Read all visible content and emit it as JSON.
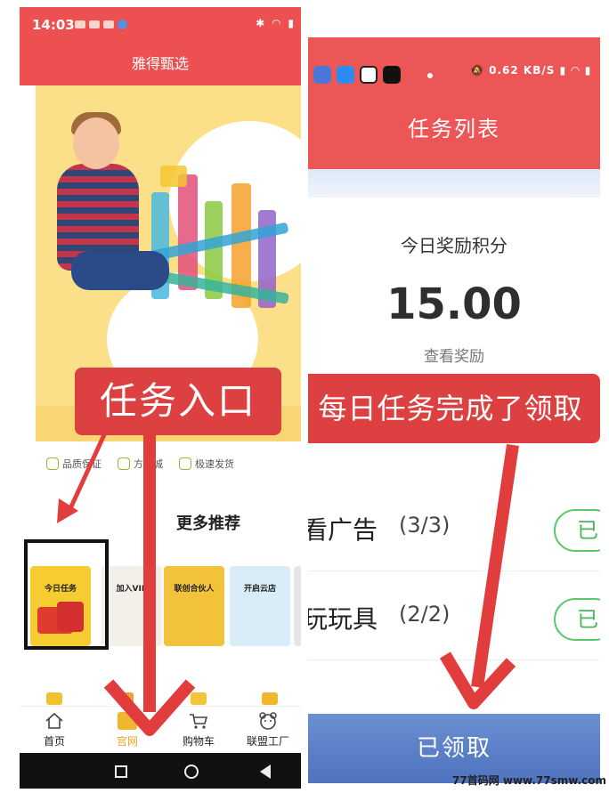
{
  "left_phone": {
    "status": {
      "time": "14:03"
    },
    "header": {
      "title": "雅得甄选"
    },
    "task_entry_label": "任务入口",
    "features": [
      "品质保证",
      "方商城",
      "极速发货"
    ],
    "more_title": "更多推荐",
    "cards": [
      {
        "title": "今日任务"
      },
      {
        "title": "加入VIP"
      },
      {
        "title": "联创合伙人"
      },
      {
        "title": "开启云店"
      }
    ],
    "tabbar": [
      {
        "label": "首页",
        "icon": "home-icon"
      },
      {
        "label": "官网",
        "icon": "grid-icon"
      },
      {
        "label": "购物车",
        "icon": "cart-icon"
      },
      {
        "label": "联盟工厂",
        "icon": "bear-icon"
      }
    ]
  },
  "right_phone": {
    "status": {
      "speed_value": "0.62",
      "speed_unit": "KB/S"
    },
    "header": {
      "title": "任务列表"
    },
    "reward_label": "今日奖励积分",
    "reward_value": "15.00",
    "view_reward_link": "查看奖励",
    "daily_claim_label": "每日任务完成了领取",
    "tasks": [
      {
        "name": "看广告",
        "progress": "(3/3)",
        "button": "已"
      },
      {
        "name": "玩玩具",
        "progress": "(2/2)",
        "button": "已"
      }
    ],
    "claimed_label": "已领取"
  },
  "watermark": "77首码网 www.77smw.com",
  "colors": {
    "brand_red": "#ec5050",
    "annotation_red": "#dc4040",
    "claimed_blue": "#5b7fc6",
    "done_green": "#5cc86b"
  }
}
